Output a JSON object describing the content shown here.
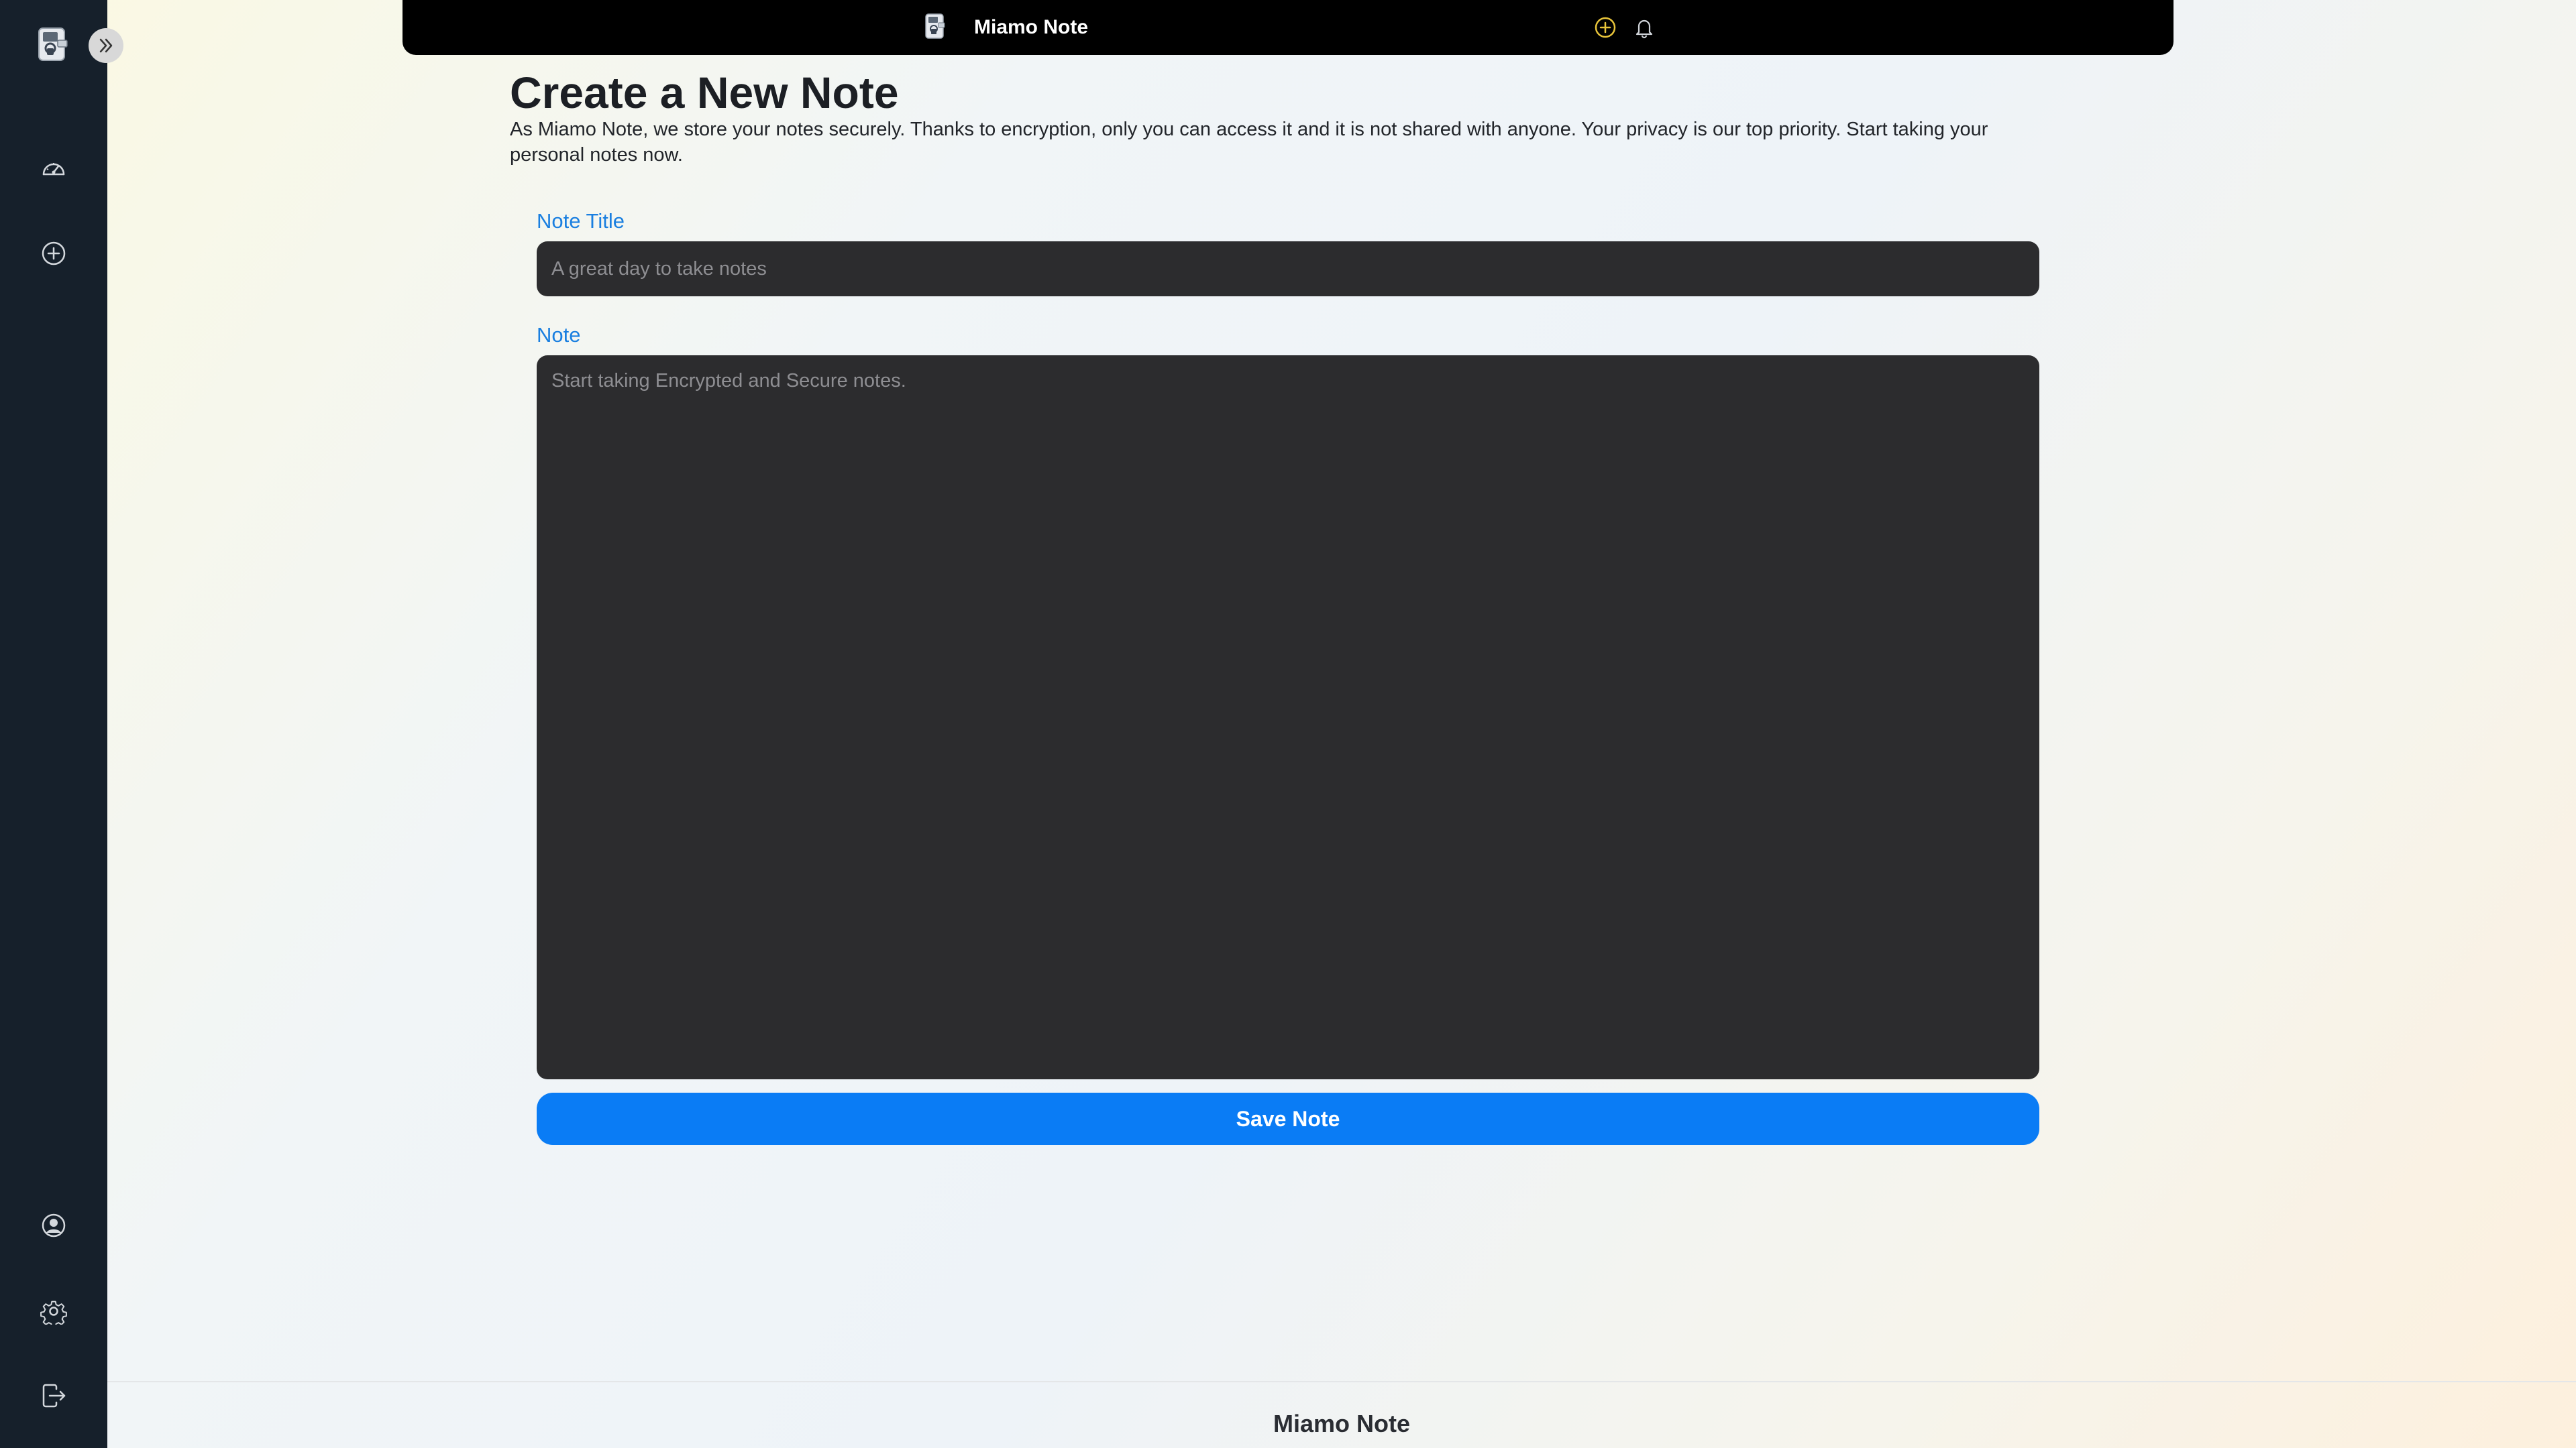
{
  "app": {
    "name": "Miamo Note"
  },
  "sidebar": {
    "items": [
      {
        "name": "dashboard-icon"
      },
      {
        "name": "add-note-icon"
      },
      {
        "name": "profile-icon"
      },
      {
        "name": "settings-icon"
      },
      {
        "name": "logout-icon"
      }
    ]
  },
  "topbar": {
    "title": "Miamo Note",
    "add_icon_color": "#e8c43a",
    "icons": [
      "plus-circle-icon",
      "bell-icon"
    ]
  },
  "main": {
    "title": "Create a New Note",
    "description": "As Miamo Note, we store your notes securely. Thanks to encryption, only you can access it and it is not shared with anyone. Your privacy is our top priority. Start taking your personal notes now.",
    "title_field": {
      "label": "Note Title",
      "placeholder": "A great day to take notes",
      "value": ""
    },
    "note_field": {
      "label": "Note",
      "placeholder": "Start taking Encrypted and Secure notes.",
      "value": ""
    },
    "save_label": "Save Note"
  },
  "footer": {
    "text": "Miamo Note"
  },
  "colors": {
    "accent": "#0a7cf5",
    "label": "#1a7fe0",
    "sidebar_bg": "#16202b",
    "input_bg": "#2c2c2e"
  }
}
